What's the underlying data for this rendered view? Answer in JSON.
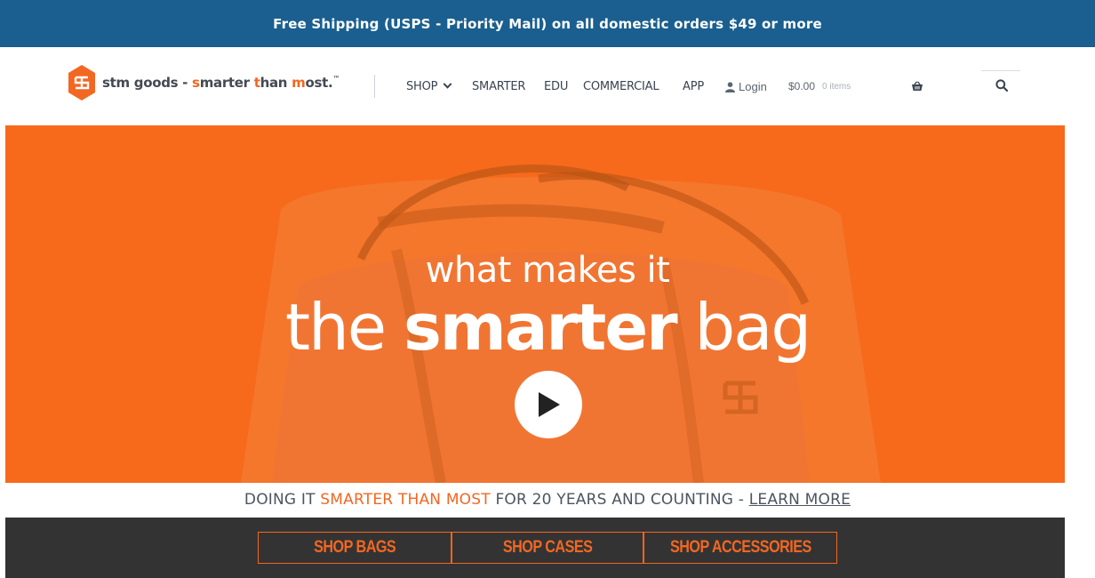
{
  "promo": {
    "text": "Free Shipping (USPS - Priority Mail) on all domestic orders $49 or more"
  },
  "header": {
    "logo": {
      "icon": "stm-hexagon-logo",
      "part1": "stm goods - ",
      "part2": "s",
      "part3": "marter ",
      "part4": "t",
      "part5": "han ",
      "part6": "m",
      "part7": "ost.",
      "tm": "™"
    },
    "nav": [
      {
        "label": "SHOP",
        "has_dropdown": true
      },
      {
        "label": "SMARTER"
      },
      {
        "label": "EDU"
      },
      {
        "label": "COMMERCIAL"
      },
      {
        "label": "APP"
      }
    ],
    "login_label": "Login",
    "cart_total": "$0.00",
    "cart_count": "0 items",
    "icons": {
      "user": "user-icon",
      "basket": "basket-icon",
      "search": "search-icon"
    }
  },
  "hero": {
    "line1": "what makes it",
    "line2_a": "the ",
    "line2_b": "smarter",
    "line2_c": " bag",
    "play_icon": "play-icon",
    "background_color": "#f76a1c"
  },
  "tagline": {
    "part1": "DOING IT ",
    "accent": "SMARTER THAN MOST",
    "part2": " FOR 20 YEARS AND COUNTING - ",
    "link": "LEARN MORE"
  },
  "shop_buttons": [
    "SHOP BAGS",
    "SHOP CASES",
    "SHOP ACCESSORIES"
  ],
  "colors": {
    "promo_bg": "#1a5f8f",
    "accent": "#f26722",
    "dark_band": "#333333",
    "text": "#4b5560"
  }
}
